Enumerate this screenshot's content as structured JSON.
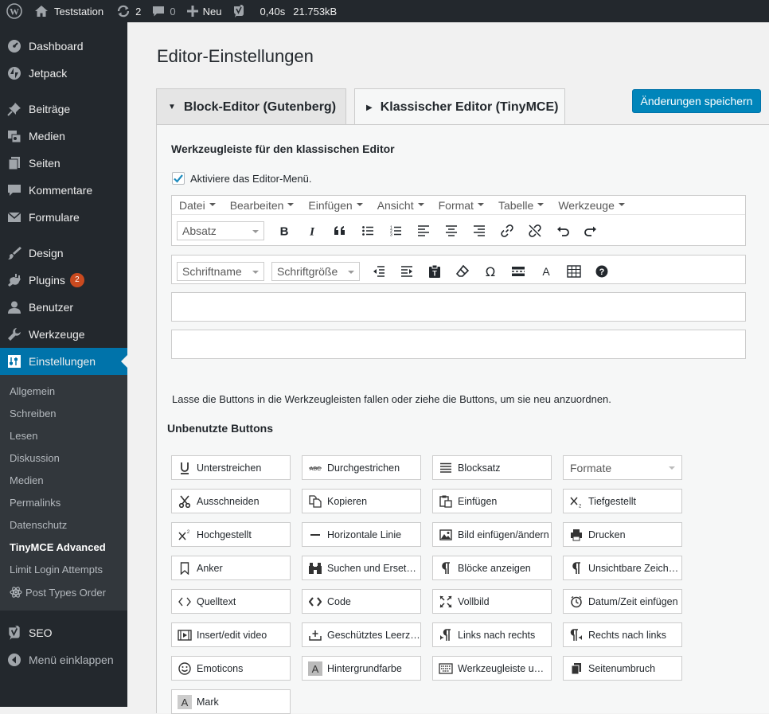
{
  "adminbar": {
    "site": "Teststation",
    "updates": "2",
    "comments": "0",
    "new": "Neu",
    "time": "0,40s",
    "size": "21.753kB"
  },
  "sidebar": {
    "items": [
      {
        "label": "Dashboard",
        "icon": "dashboard-icon"
      },
      {
        "label": "Jetpack",
        "icon": "jetpack-icon"
      },
      {
        "label": "Beiträge",
        "icon": "pin-icon"
      },
      {
        "label": "Medien",
        "icon": "media-icon"
      },
      {
        "label": "Seiten",
        "icon": "pages-icon"
      },
      {
        "label": "Kommentare",
        "icon": "comments-icon"
      },
      {
        "label": "Formulare",
        "icon": "mail-icon"
      },
      {
        "label": "Design",
        "icon": "brush-icon"
      },
      {
        "label": "Plugins",
        "icon": "plugin-icon",
        "badge": "2"
      },
      {
        "label": "Benutzer",
        "icon": "user-icon"
      },
      {
        "label": "Werkzeuge",
        "icon": "wrench-icon"
      },
      {
        "label": "Einstellungen",
        "icon": "settings-icon"
      },
      {
        "label": "SEO",
        "icon": "yoast-icon"
      },
      {
        "label": "Menü einklappen",
        "icon": "collapse-icon"
      }
    ],
    "submenu": [
      "Allgemein",
      "Schreiben",
      "Lesen",
      "Diskussion",
      "Medien",
      "Permalinks",
      "Datenschutz",
      "TinyMCE Advanced",
      "Limit Login Attempts",
      "Post Types Order"
    ]
  },
  "page": {
    "title": "Editor-Einstellungen",
    "tab_block": "Block-Editor (Gutenberg)",
    "tab_classic": "Klassischer Editor (TinyMCE)",
    "save": "Änderungen speichern"
  },
  "toolbar_section": {
    "title": "Werkzeugleiste für den klassischen Editor",
    "checkbox": "Aktiviere das Editor-Menü.",
    "menus": [
      "Datei",
      "Bearbeiten",
      "Einfügen",
      "Ansicht",
      "Format",
      "Tabelle",
      "Werkzeuge"
    ],
    "format_select": "Absatz",
    "font_name": "Schriftname",
    "font_size": "Schriftgröße",
    "hint": "Lasse die Buttons in die Werkzeugleisten fallen oder ziehe die Buttons, um sie neu anzuordnen."
  },
  "unused": {
    "title": "Unbenutzte Buttons",
    "buttons": [
      {
        "label": "Unterstreichen",
        "icon": "underline-icon"
      },
      {
        "label": "Durchgestrichen",
        "icon": "strikethrough-icon"
      },
      {
        "label": "Blocksatz",
        "icon": "justify-icon"
      },
      {
        "label": "Formate",
        "icon": "select"
      },
      {
        "label": "Ausschneiden",
        "icon": "scissors-icon"
      },
      {
        "label": "Kopieren",
        "icon": "copy-icon"
      },
      {
        "label": "Einfügen",
        "icon": "paste-icon"
      },
      {
        "label": "Tiefgestellt",
        "icon": "subscript-icon"
      },
      {
        "label": "Hochgestellt",
        "icon": "superscript-icon"
      },
      {
        "label": "Horizontale Linie",
        "icon": "hr-icon"
      },
      {
        "label": "Bild einfügen/ändern",
        "icon": "image-icon"
      },
      {
        "label": "Drucken",
        "icon": "print-icon"
      },
      {
        "label": "Anker",
        "icon": "bookmark-icon"
      },
      {
        "label": "Suchen und Ersetzen",
        "icon": "binoculars-icon"
      },
      {
        "label": "Blöcke anzeigen",
        "icon": "pilcrow-icon"
      },
      {
        "label": "Unsichtbare Zeiche...",
        "icon": "pilcrow-icon"
      },
      {
        "label": "Quelltext",
        "icon": "code-icon"
      },
      {
        "label": "Code",
        "icon": "code-bold-icon"
      },
      {
        "label": "Vollbild",
        "icon": "fullscreen-icon"
      },
      {
        "label": "Datum/Zeit einfügen",
        "icon": "clock-icon"
      },
      {
        "label": "Insert/edit video",
        "icon": "video-icon"
      },
      {
        "label": "Geschütztes Leerzei...",
        "icon": "nbsp-icon"
      },
      {
        "label": "Links nach rechts",
        "icon": "ltr-icon"
      },
      {
        "label": "Rechts nach links",
        "icon": "rtl-icon"
      },
      {
        "label": "Emoticons",
        "icon": "emoticon-icon"
      },
      {
        "label": "Hintergrundfarbe",
        "icon": "bgcolor-icon"
      },
      {
        "label": "Werkzeugleiste ums...",
        "icon": "keyboard-icon"
      },
      {
        "label": "Seitenumbruch",
        "icon": "pagebreak-icon"
      },
      {
        "label": "Mark",
        "icon": "mark-icon"
      }
    ]
  }
}
